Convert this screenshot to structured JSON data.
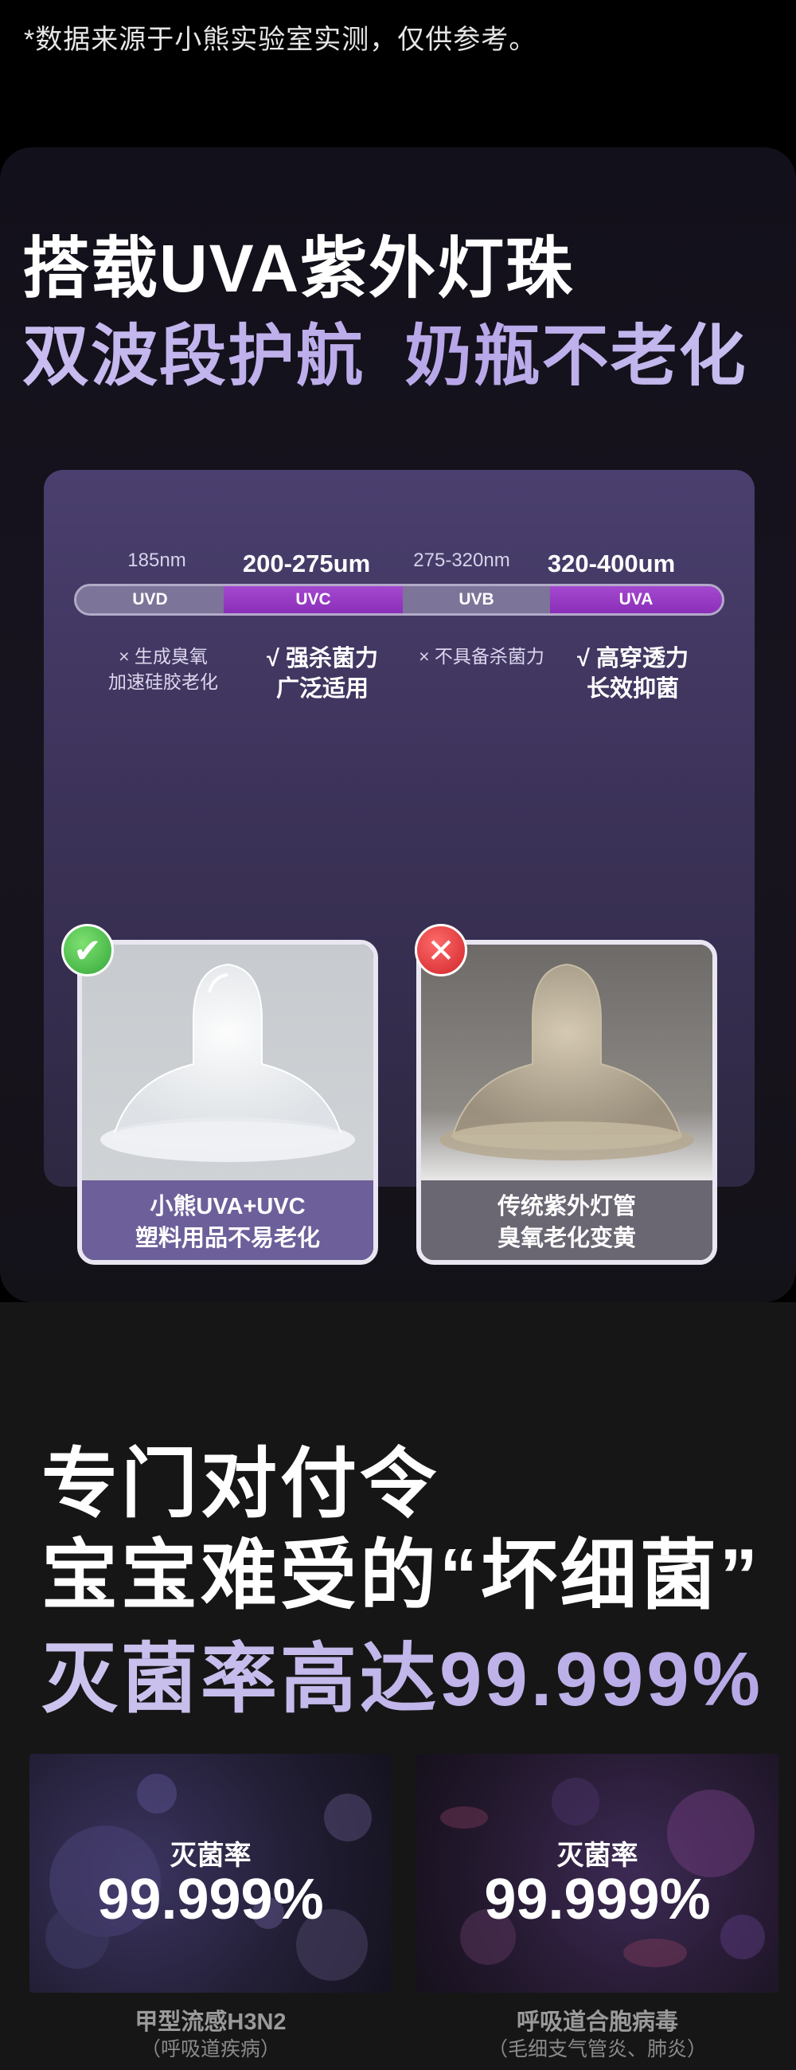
{
  "disclaimer": "*数据来源于小熊实验室实测，仅供参考。",
  "section1": {
    "headline_line1": "搭载UVA紫外灯珠",
    "headline_line2": "双波段护航  奶瓶不老化",
    "spectrum": {
      "wavelengths": [
        "185nm",
        "200-275um",
        "275-320nm",
        "320-400um"
      ],
      "bands": [
        "UVD",
        "UVC",
        "UVB",
        "UVA"
      ],
      "descriptions": [
        {
          "line1": "× 生成臭氧",
          "line2": "加速硅胶老化"
        },
        {
          "line1": "√ 强杀菌力",
          "line2": "广泛适用"
        },
        {
          "line1": "× 不具备杀菌力",
          "line2": ""
        },
        {
          "line1": "√ 高穿透力",
          "line2": "长效抑菌"
        }
      ]
    },
    "compare": {
      "good": {
        "line1": "小熊UVA+UVC",
        "line2": "塑料用品不易老化",
        "badge": "✔"
      },
      "bad": {
        "line1": "传统紫外灯管",
        "line2": "臭氧老化变黄",
        "badge": "✕"
      }
    }
  },
  "section2": {
    "headline_line1": "专门对付令",
    "headline_line2": "宝宝难受的“坏细菌”",
    "headline_line3": "灭菌率高达99.999%",
    "viruses": [
      {
        "label": "灭菌率",
        "value": "99.999%",
        "name": "甲型流感H3N2",
        "sub": "（呼吸道疾病）"
      },
      {
        "label": "灭菌率",
        "value": "99.999%",
        "name": "呼吸道合胞病毒",
        "sub": "（毛细支气管炎、肺炎）"
      }
    ]
  },
  "colors": {
    "accent_purple": "#9b3fc8",
    "panel_purple": "#4a3f6e",
    "good_green": "#3fb34a",
    "bad_red": "#d62f2f"
  }
}
